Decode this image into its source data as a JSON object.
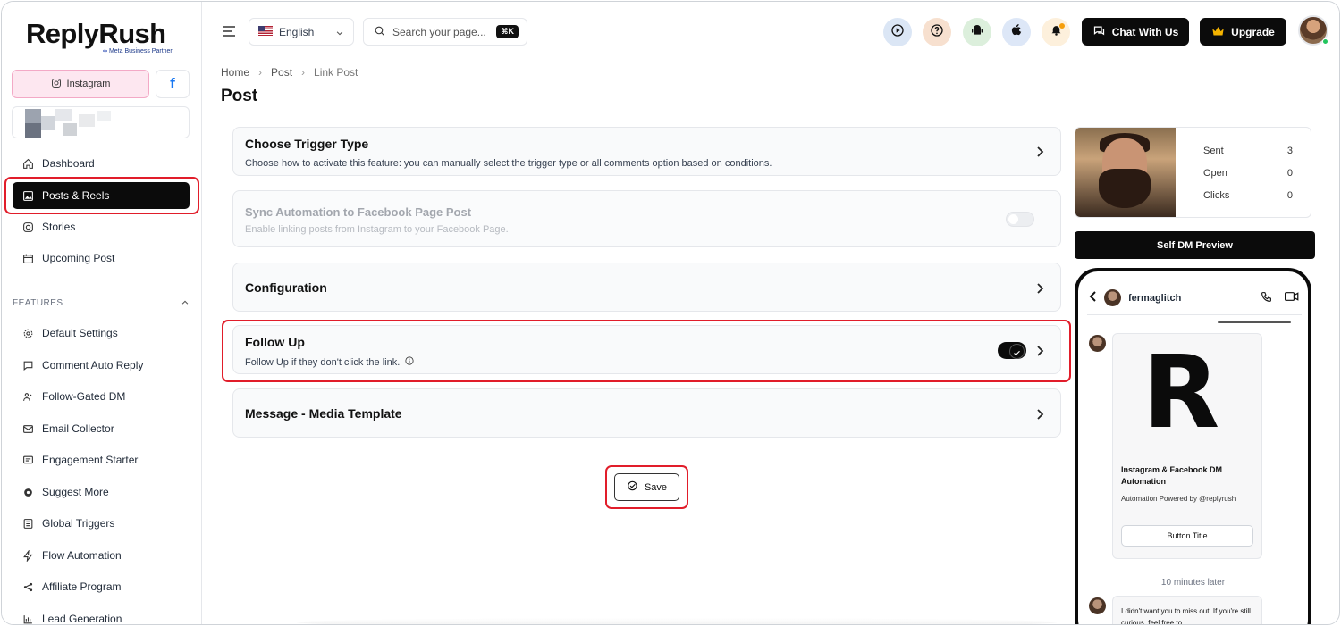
{
  "brand": {
    "name": "ReplyRush",
    "partner": "Meta Business Partner"
  },
  "sidebar": {
    "instagram_label": "Instagram",
    "facebook_label": "f",
    "items": [
      {
        "label": "Dashboard"
      },
      {
        "label": "Posts & Reels"
      },
      {
        "label": "Stories"
      },
      {
        "label": "Upcoming Post"
      }
    ],
    "features_heading": "FEATURES",
    "features": [
      {
        "label": "Default Settings"
      },
      {
        "label": "Comment Auto Reply"
      },
      {
        "label": "Follow-Gated DM"
      },
      {
        "label": "Email Collector"
      },
      {
        "label": "Engagement Starter"
      },
      {
        "label": "Suggest More"
      },
      {
        "label": "Global Triggers"
      },
      {
        "label": "Flow Automation"
      },
      {
        "label": "Affiliate Program"
      },
      {
        "label": "Lead Generation"
      }
    ]
  },
  "topbar": {
    "language": "English",
    "search_placeholder": "Search your page...",
    "shortcut": "⌘K",
    "chat_label": "Chat With Us",
    "upgrade_label": "Upgrade"
  },
  "breadcrumb": [
    "Home",
    "Post",
    "Link Post"
  ],
  "page_title": "Post",
  "cards": {
    "trigger": {
      "title": "Choose Trigger Type",
      "desc": "Choose how to activate this feature: you can manually select the trigger type or all comments option based on conditions."
    },
    "sync": {
      "title": "Sync Automation to Facebook Page Post",
      "desc": "Enable linking posts from Instagram to your Facebook Page."
    },
    "config": {
      "title": "Configuration"
    },
    "followup": {
      "title": "Follow Up",
      "desc": "Follow Up if they don't click the link."
    },
    "media": {
      "title": "Message - Media Template"
    }
  },
  "save_label": "Save",
  "stats": [
    {
      "label": "Sent",
      "value": "3"
    },
    {
      "label": "Open",
      "value": "0"
    },
    {
      "label": "Clicks",
      "value": "0"
    }
  ],
  "preview": {
    "button": "Self DM Preview",
    "username": "fermaglitch",
    "logo_letter": "R",
    "card_title": "Instagram & Facebook DM Automation",
    "card_sub": "Automation Powered by @replyrush",
    "card_button": "Button Title",
    "later": "10 minutes later",
    "followup_msg": "I didn't want you to miss out! If you're still curious, feel free to"
  },
  "colors": {
    "accent": "#0b0b0b",
    "highlight": "#e11d2a",
    "instagram_bg": "#fde7f0"
  }
}
